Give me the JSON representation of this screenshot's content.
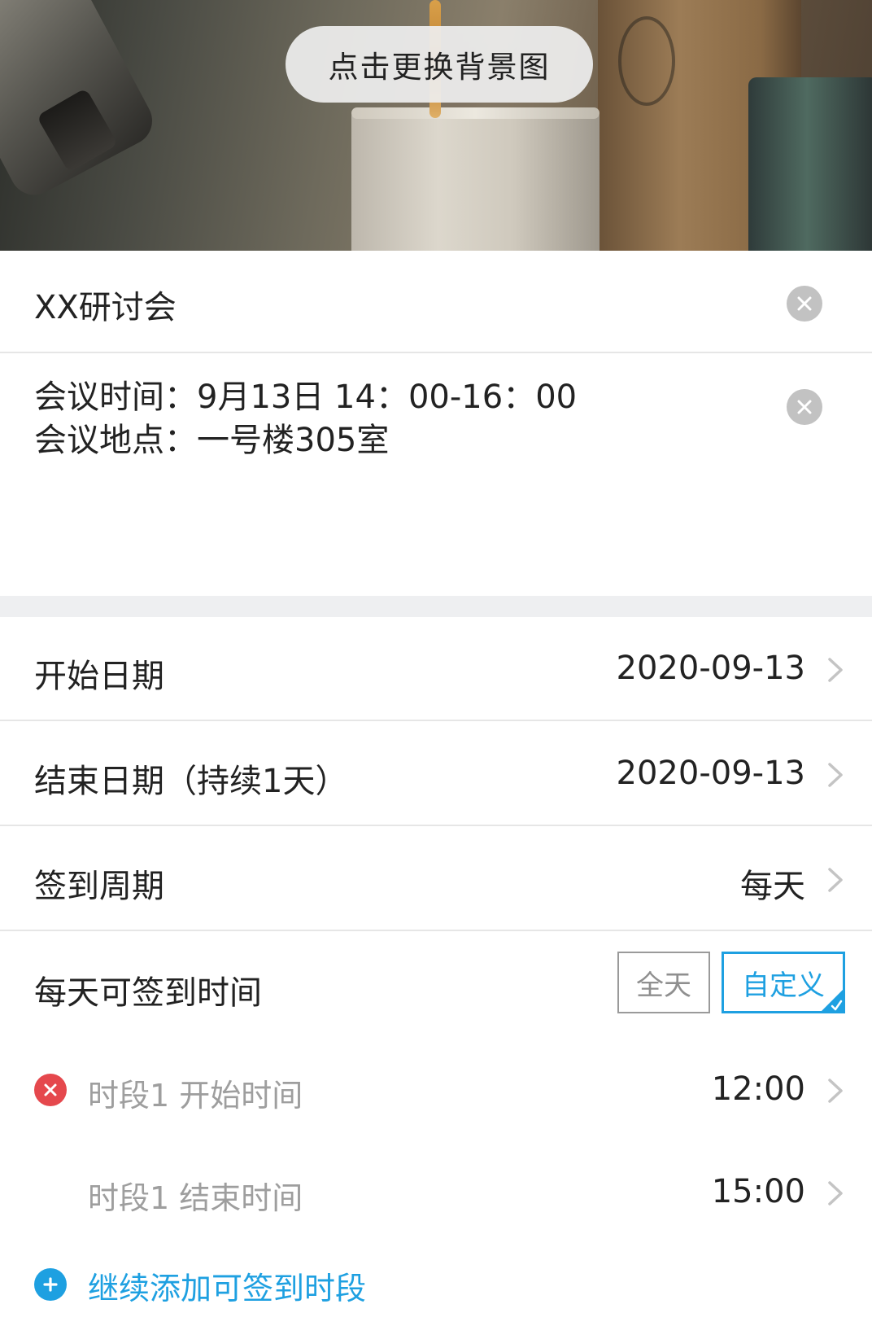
{
  "header": {
    "change_background_label": "点击更换背景图"
  },
  "meeting": {
    "title": "XX研讨会",
    "description_line1": "会议时间：9月13日 14：00-16：00",
    "description_line2": "会议地点：一号楼305室"
  },
  "settings": {
    "start_date_label": "开始日期",
    "start_date_value": "2020-09-13",
    "end_date_label": "结束日期（持续1天）",
    "end_date_value": "2020-09-13",
    "cycle_label": "签到周期",
    "cycle_value": "每天",
    "daily_time_label": "每天可签到时间",
    "option_allday": "全天",
    "option_custom": "自定义",
    "selected_option": "自定义"
  },
  "slots": [
    {
      "start_label": "时段1 开始时间",
      "start_value": "12:00",
      "end_label": "时段1 结束时间",
      "end_value": "15:00"
    }
  ],
  "add_slot_label": "继续添加可签到时段",
  "colors": {
    "accent": "#1ea0e1",
    "danger": "#e5484d",
    "divider": "#e6e6e6",
    "section_gap": "#eeeff1"
  },
  "icons": {
    "clear": "clear-icon",
    "chevron": "chevron-right-icon",
    "remove": "remove-circle-icon",
    "add": "add-circle-icon",
    "check": "check-corner-icon"
  }
}
